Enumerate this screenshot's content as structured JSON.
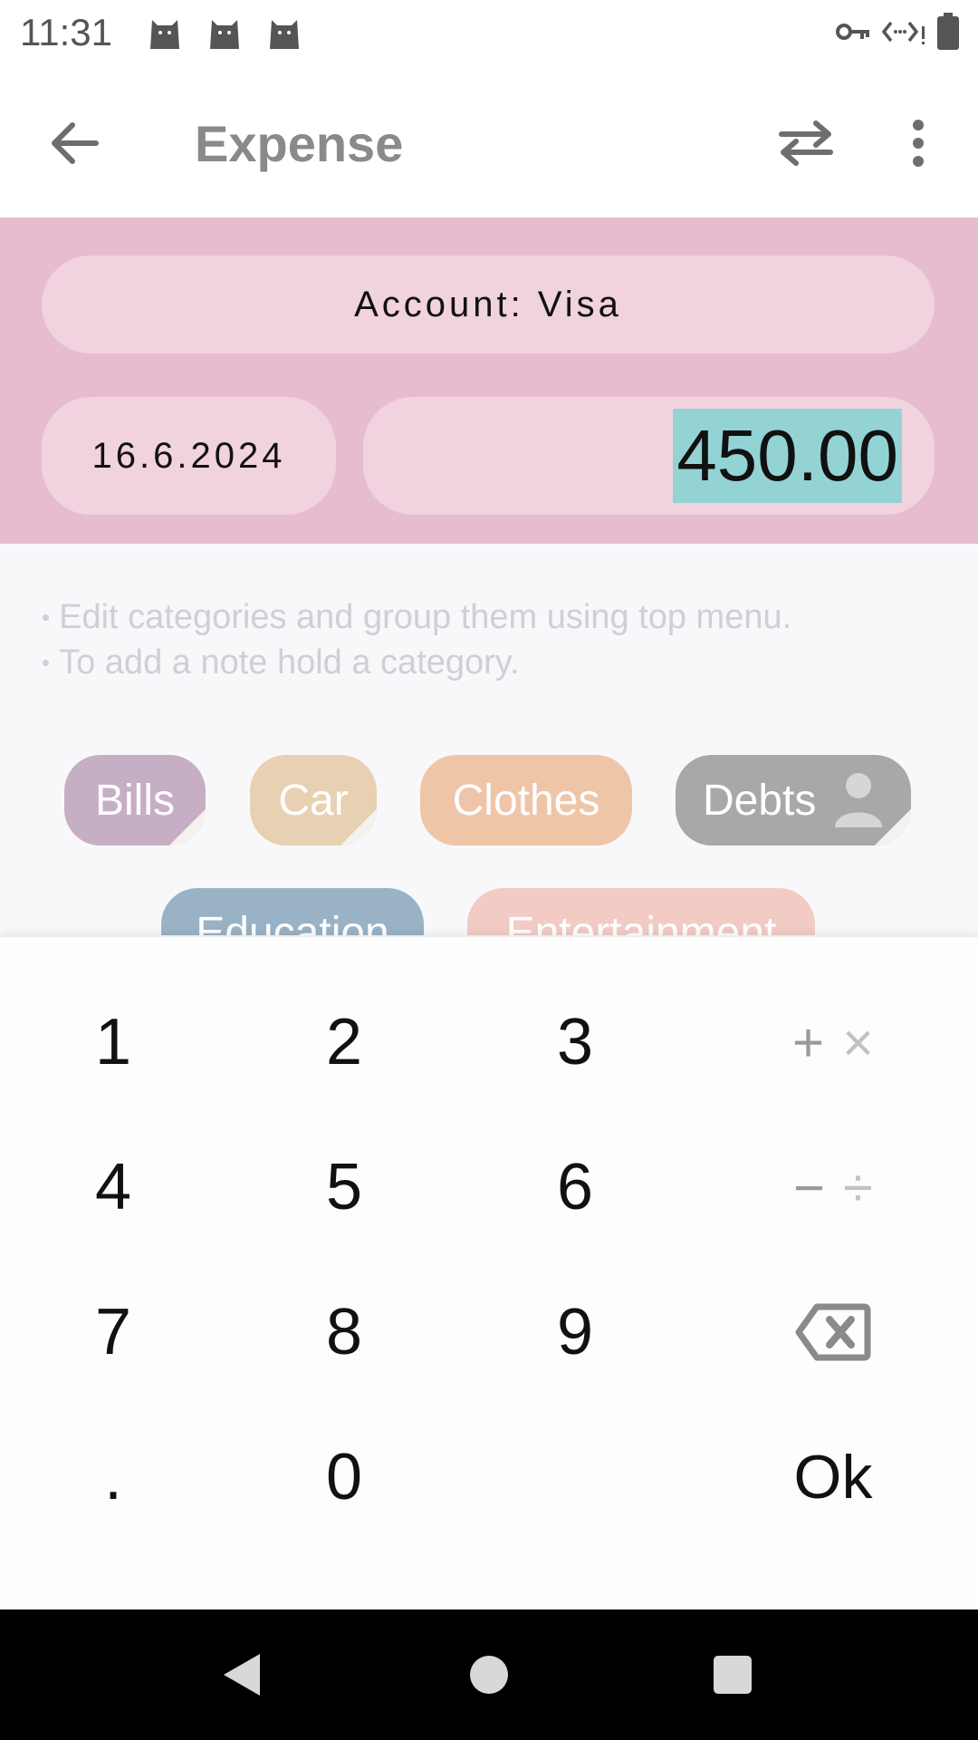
{
  "status_bar": {
    "time": "11:31",
    "icons": [
      "cat-icon",
      "cat-icon",
      "cat-icon",
      "vpn-key-icon",
      "data-saver-icon",
      "battery-icon"
    ]
  },
  "app_bar": {
    "title": "Expense",
    "icons": [
      "back-arrow-icon",
      "swap-icon",
      "more-vert-icon"
    ]
  },
  "header": {
    "account_label": "Account: Visa",
    "date": "16.6.2024",
    "amount": "450.00",
    "colors": {
      "background": "#e8bccf",
      "pill": "#f1d2df",
      "amount_highlight": "#94d3d4"
    }
  },
  "hints": [
    "Edit categories and group them using top menu.",
    "To add a note hold a category."
  ],
  "categories": [
    {
      "label": "Bills",
      "color": "#c6aec4"
    },
    {
      "label": "Car",
      "color": "#e8d1b2"
    },
    {
      "label": "Clothes",
      "color": "#efc5a8"
    },
    {
      "label": "Debts",
      "color": "#a9a8a9"
    },
    {
      "label": "Education",
      "color": "#99b2c6"
    },
    {
      "label": "Entertainment",
      "color": "#f2cbc5"
    }
  ],
  "keypad": {
    "row1": [
      "1",
      "2",
      "3"
    ],
    "row2": [
      "4",
      "5",
      "6"
    ],
    "row3": [
      "7",
      "8",
      "9"
    ],
    "row4": [
      ".",
      "0"
    ],
    "ops": {
      "plus": "+",
      "times": "×",
      "minus": "−",
      "divide": "÷"
    },
    "ok_label": "Ok",
    "backspace_icon": "backspace-icon"
  },
  "nav_bar": {
    "icons": [
      "nav-back-icon",
      "nav-home-icon",
      "nav-recents-icon"
    ]
  }
}
